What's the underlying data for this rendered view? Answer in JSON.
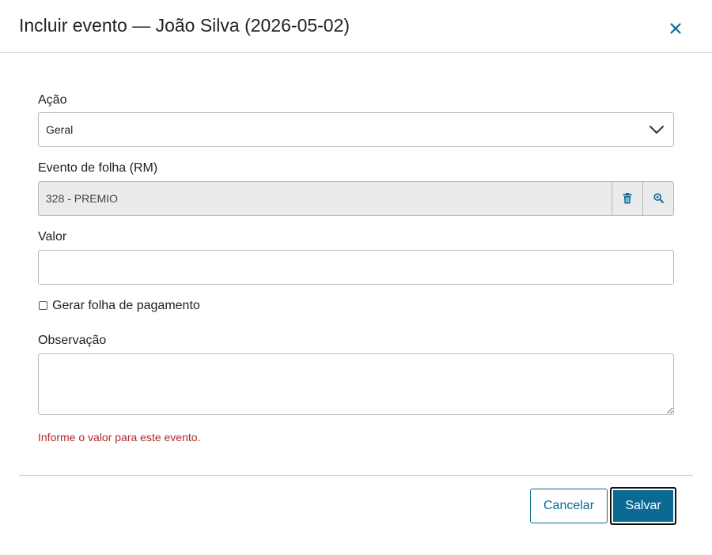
{
  "modal": {
    "title": "Incluir evento — João Silva (2026-05-02)",
    "close_icon": "close-icon"
  },
  "form": {
    "acao": {
      "label": "Ação",
      "selected": "Geral",
      "icon": "chevron-down-icon"
    },
    "evento": {
      "label": "Evento de folha (RM)",
      "value": "328 - PREMIO",
      "delete_icon": "trash-icon",
      "search_icon": "search-icon"
    },
    "valor": {
      "label": "Valor",
      "value": ""
    },
    "gerar_folha": {
      "label": "Gerar folha de pagamento",
      "checked": false
    },
    "observacao": {
      "label": "Observação",
      "value": ""
    },
    "error_message": "Informe o valor para este evento."
  },
  "footer": {
    "cancel_label": "Cancelar",
    "save_label": "Salvar"
  },
  "colors": {
    "accent": "#0b6a94",
    "error": "#b02a2a",
    "readonly_bg": "#ebebeb"
  }
}
